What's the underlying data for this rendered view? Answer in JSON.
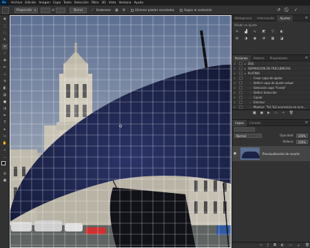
{
  "menu": {
    "logo": "Ps",
    "items": [
      "Archivo",
      "Edición",
      "Imagen",
      "Capa",
      "Texto",
      "Selección",
      "Filtro",
      "3D",
      "Vista",
      "Ventana",
      "Ayuda"
    ]
  },
  "options": {
    "mode_select": "Proporción",
    "clear_button": "Borrar",
    "straighten_label": "Enderezar",
    "delete_cropped_label": "Eliminar píxeles recortados",
    "content_aware_label": "Según el contenido"
  },
  "panels": {
    "top_tabs": [
      "Histograma",
      "Información",
      "Ajustes"
    ],
    "adjust_title": "Añadir un ajuste",
    "actions_tabs": [
      "Acciones",
      "Historia",
      "Propiedades"
    ],
    "actions": [
      {
        "label": "DGE",
        "indent": 1
      },
      {
        "label": "SEPARACION DE FRECUENCIAS",
        "indent": 1
      },
      {
        "label": "PLATINO",
        "indent": 1
      },
      {
        "label": "Crear capa de ajuste",
        "indent": 3
      },
      {
        "label": "Definir capa de ajuste actual",
        "indent": 3
      },
      {
        "label": "Selección capa \"Fondo\"",
        "indent": 3
      },
      {
        "label": "Definir Selección",
        "indent": 3
      },
      {
        "label": "Copiar",
        "indent": 3
      },
      {
        "label": "Eliminar",
        "indent": 3
      },
      {
        "label": "Mostrar: \"%1 %2 ocurrencia en la m...",
        "indent": 3
      }
    ],
    "layers_tabs": [
      "Capas",
      "Canales"
    ],
    "blend_mode": "Normal",
    "opacity_label": "Opacidad:",
    "opacity_value": "100%",
    "fill_label": "Relleno:",
    "fill_value": "100%",
    "layer_name": "Previsualización de recorte"
  },
  "colors": {
    "accent": "#31a8ff",
    "sky": "#6a7b9c",
    "umbrella": "#1f2547",
    "building": "#c9c3b6"
  }
}
